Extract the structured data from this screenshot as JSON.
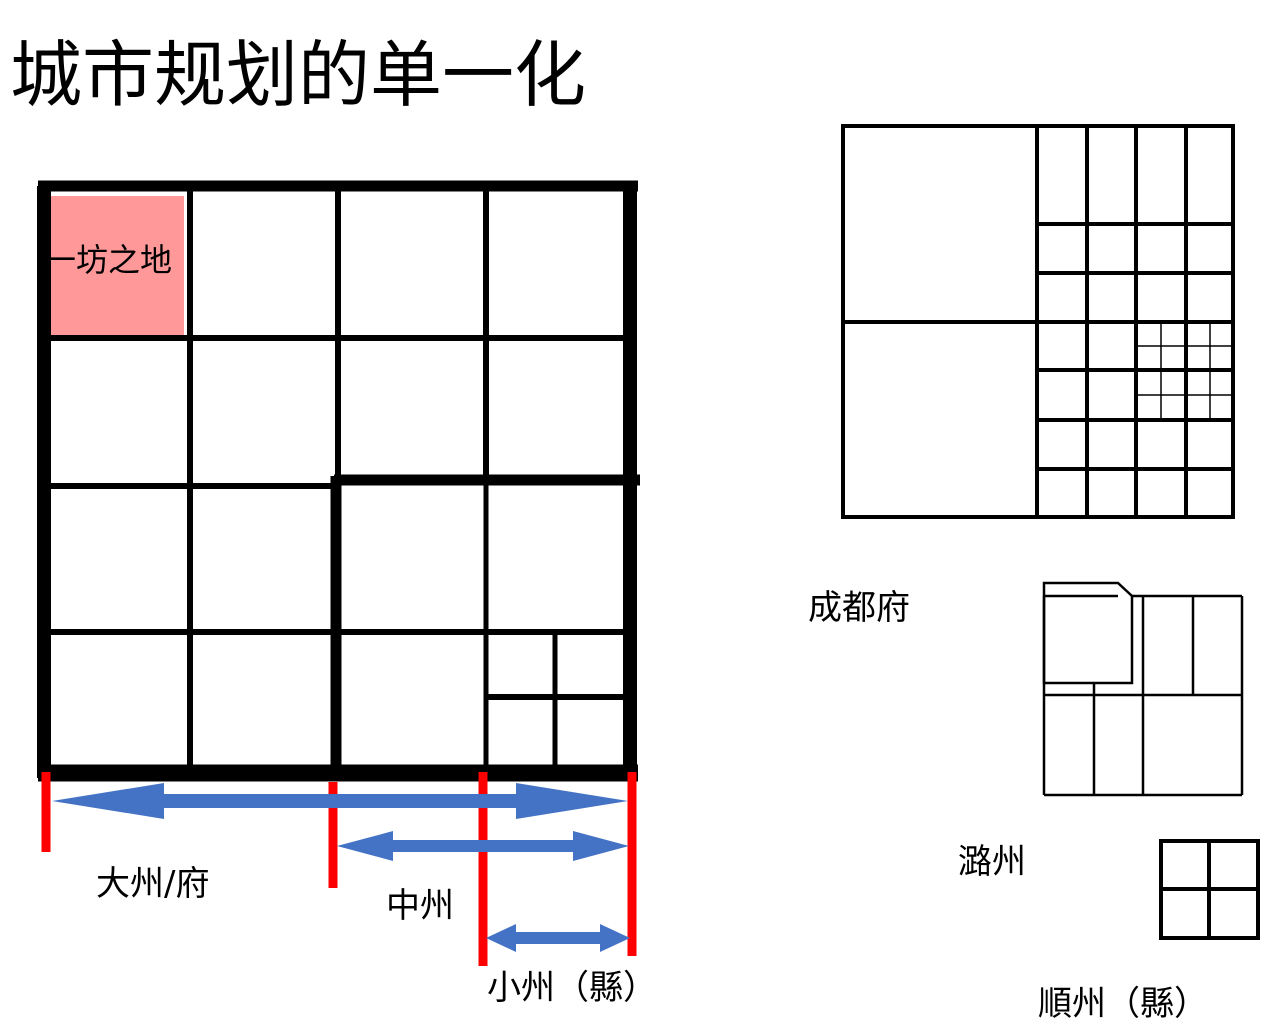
{
  "title": "城市规划的单一化",
  "labels": {
    "fang": "一坊之地",
    "dazhou": "大州/府",
    "zhongzhou": "中州",
    "xiaozhou": "小州（縣）",
    "chengdu": "成都府",
    "luzhou": "潞州",
    "shunzhou": "順州（縣）"
  },
  "colors": {
    "fang_fill": "#ff9999",
    "boundary_marker": "#ff0000",
    "span_arrow": "#4472c4",
    "line": "#000000"
  }
}
